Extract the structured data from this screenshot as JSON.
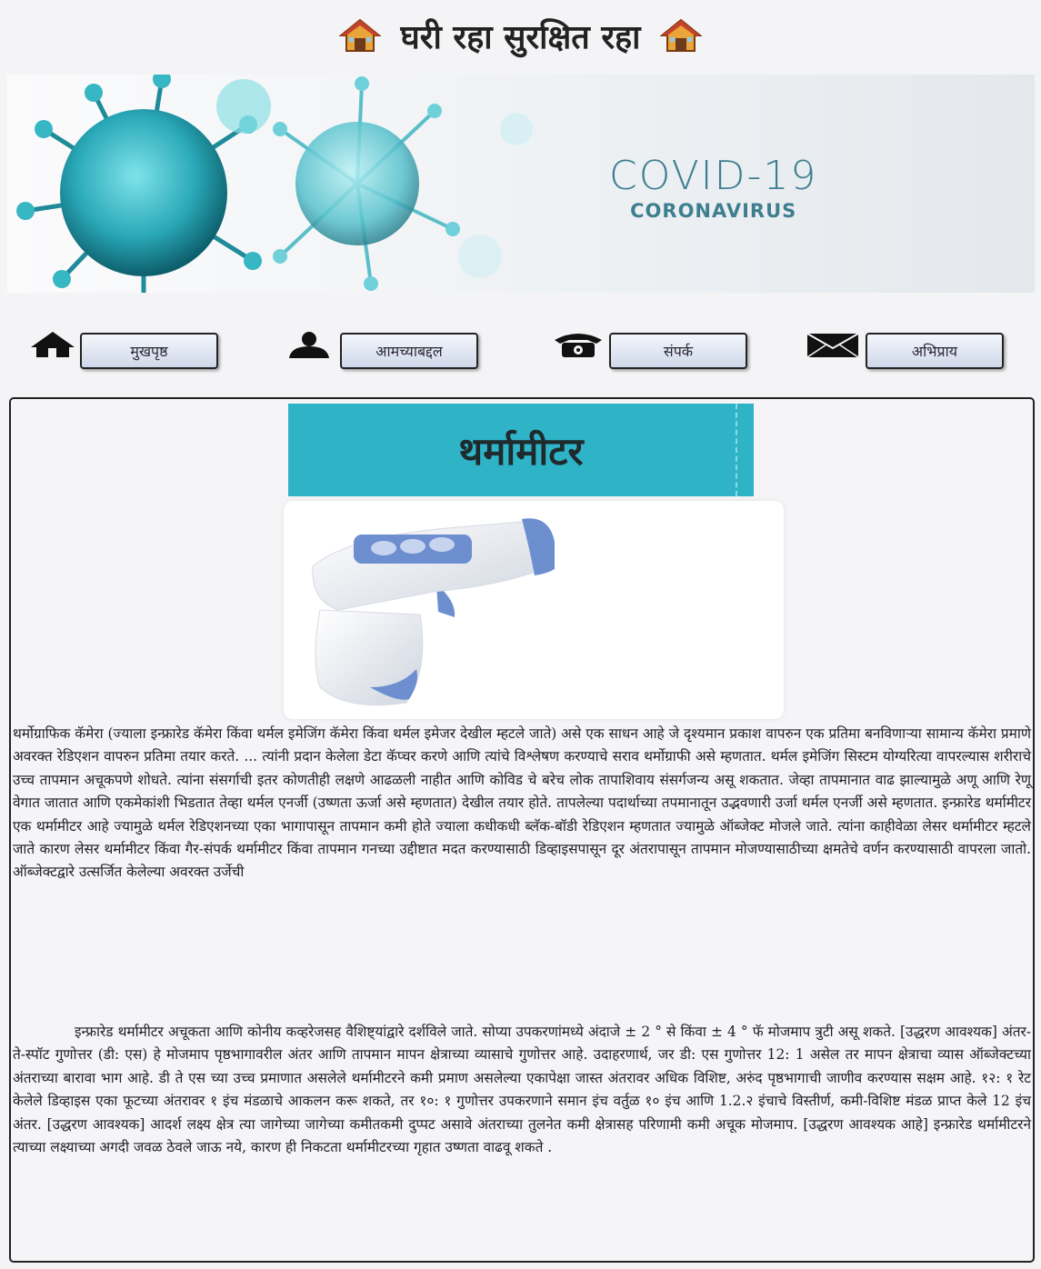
{
  "header": {
    "title": "घरी रहा सुरक्षित रहा",
    "left_icon": "house-icon",
    "right_icon": "house-icon"
  },
  "banner": {
    "title": "COVID-19",
    "subtitle": "CORONAVIRUS",
    "accent_color": "#3e7f8f"
  },
  "nav": {
    "items": [
      {
        "icon": "home-icon",
        "label": "मुखपृष्ठ"
      },
      {
        "icon": "user-icon",
        "label": "आमच्याबद्दल"
      },
      {
        "icon": "phone-icon",
        "label": "संपर्क"
      },
      {
        "icon": "mail-icon",
        "label": "अभिप्राय"
      }
    ]
  },
  "main": {
    "title": "थर्मामीटर",
    "title_bg": "#2fb3c7",
    "paragraphs": [
      "थर्मोग्राफिक कॅमेरा (ज्याला इन्फ्रारेड कॅमेरा किंवा थर्मल इमेजिंग कॅमेरा किंवा थर्मल इमेजर देखील म्हटले जाते) असे एक साधन आहे जे दृश्यमान प्रकाश वापरुन एक प्रतिमा बनविणाऱ्या सामान्य कॅमेरा प्रमाणे अवरक्त रेडिएशन वापरुन प्रतिमा तयार करते. ... त्यांनी प्रदान केलेला डेटा कॅप्चर करणे आणि त्यांचे विश्लेषण करण्याचे सराव थर्मोग्राफी असे म्हणतात. थर्मल इमेजिंग सिस्टम योग्यरित्या वापरल्यास शरीराचे उच्च तापमान अचूकपणे शोधते. त्यांना संसर्गाची इतर कोणतीही लक्षणे आढळली नाहीत आणि कोविड चे बरेच लोक तापाशिवाय संसर्गजन्य असू शकतात. जेव्हा तापमानात वाढ झाल्यामुळे अणू आणि रेणू वेगात जातात आणि एकमेकांशी भिडतात तेव्हा थर्मल एनर्जी (उष्णता ऊर्जा असे म्हणतात) देखील तयार होते. तापलेल्या पदार्थाच्या तपमानातून उद्भवणारी उर्जा थर्मल एनर्जी असे म्हणतात. इन्फ्रारेड थर्मामीटर एक थर्मामीटर आहे ज्यामुळे थर्मल रेडिएशनच्या एका भागापासून तापमान कमी होते ज्याला कधीकधी ब्लॅक-बॉडी रेडिएशन म्हणतात ज्यामुळे ऑब्जेक्ट मोजले जाते. त्यांना काहीवेळा लेसर थर्मामीटर म्हटले जाते कारण लेसर थर्मामीटर किंवा गैर-संपर्क थर्मामीटर किंवा तापमान गनच्या उद्दीष्टात मदत करण्यासाठी डिव्हाइसपासून दूर अंतरापासून तापमान मोजण्यासाठीच्या क्षमतेचे वर्णन करण्यासाठी वापरला जातो. ऑब्जेक्टद्वारे उत्सर्जित केलेल्या अवरक्त उर्जेची",
      "इन्फ्रारेड थर्मामीटर अचूकता आणि कोनीय कव्हरेजसह वैशिष्ट्यांद्वारे दर्शविले जाते. सोप्या उपकरणांमध्ये अंदाजे ± 2 ° से किंवा ± 4 ° फॅ मोजमाप त्रुटी असू शकते. [उद्धरण आवश्यक] अंतर-ते-स्पॉट गुणोत्तर (डी: एस) हे मोजमाप पृष्ठभागावरील अंतर आणि तापमान मापन क्षेत्राच्या व्यासाचे गुणोत्तर आहे. उदाहरणार्थ, जर डी: एस गुणोत्तर 12: 1 असेल तर मापन क्षेत्राचा व्यास ऑब्जेक्टच्या अंतराच्या बारावा भाग आहे. डी ते एस च्या उच्च प्रमाणात असलेले थर्मामीटरने कमी प्रमाण असलेल्या एकापेक्षा जास्त अंतरावर अधिक विशिष्ट, अरुंद पृष्ठभागाची जाणीव करण्यास सक्षम आहे. १२: १ रेट केलेले डिव्हाइस एका फूटच्या अंतरावर १ इंच मंडळाचे आकलन करू शकते, तर १०: १ गुणोत्तर उपकरणाने समान इंच वर्तुळ १० इंच आणि 1.2.२ इंचाचे विस्तीर्ण, कमी-विशिष्ट मंडळ प्राप्त केले 12 इंच अंतर. [उद्धरण आवश्यक] आदर्श लक्ष्य क्षेत्र त्या जागेच्या जागेच्या कमीतकमी दुप्पट असावे अंतराच्या तुलनेत कमी क्षेत्रासह परिणामी कमी अचूक मोजमाप. [उद्धरण आवश्यक आहे] इन्फ्रारेड थर्मामीटरने त्याच्या लक्ष्याच्या अगदी जवळ ठेवले जाऊ नये, कारण ही निकटता थर्मामीटरच्या गृहात उष्णता वाढवू शकते ."
    ]
  }
}
